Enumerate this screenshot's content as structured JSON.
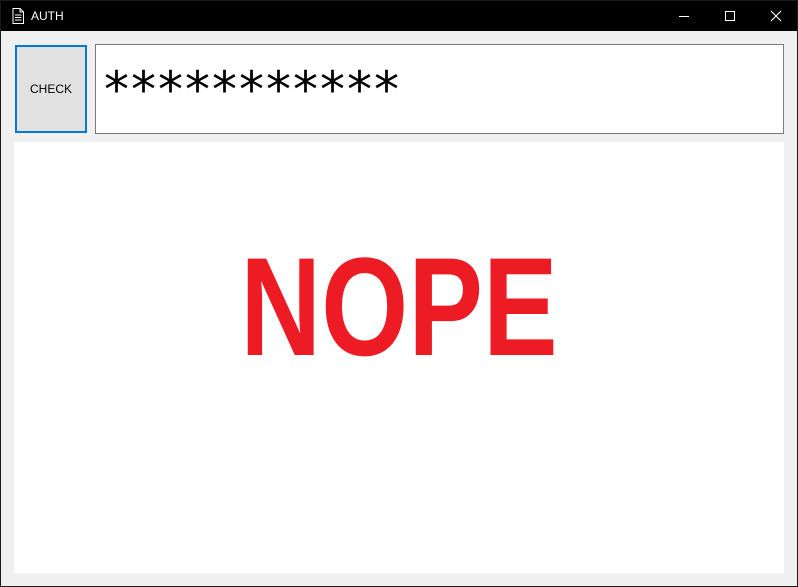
{
  "window": {
    "title": "AUTH",
    "icon": "document-icon",
    "controls": {
      "minimize": "minimize-icon",
      "maximize": "maximize-icon",
      "close": "close-icon"
    }
  },
  "form": {
    "check_label": "CHECK",
    "password_value": "***********"
  },
  "result": {
    "text": "NOPE",
    "color": "#ed1c24"
  },
  "colors": {
    "titlebar": "#000000",
    "focus_border": "#0078d7",
    "window_bg": "#f0f0f0"
  }
}
